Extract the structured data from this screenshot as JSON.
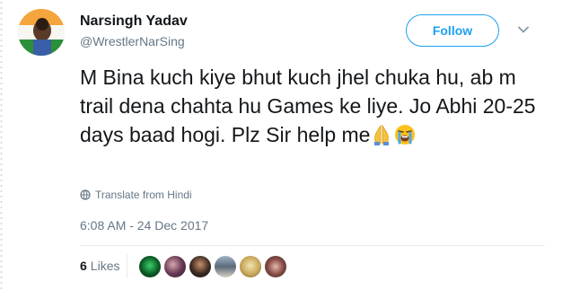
{
  "user": {
    "name": "Narsingh Yadav",
    "handle": "@WrestlerNarSing"
  },
  "actions": {
    "follow_label": "Follow"
  },
  "tweet": {
    "text": "M Bina kuch kiye bhut kuch jhel chuka hu, ab m trail dena chahta hu Games ke liye. Jo Abhi 20-25 days baad hogi. Plz Sir help me",
    "emojis": [
      "folded-hands-emoji",
      "loudly-crying-face-emoji"
    ],
    "translate_label": "Translate from Hindi",
    "timestamp": "6:08 AM - 24 Dec 2017"
  },
  "engagement": {
    "likes_count": "6",
    "likes_label": "Likes",
    "liker_avatar_count": 6
  },
  "colors": {
    "accent": "#1da1f2",
    "text": "#14171a",
    "muted": "#657786",
    "border": "#e6ecf0"
  }
}
